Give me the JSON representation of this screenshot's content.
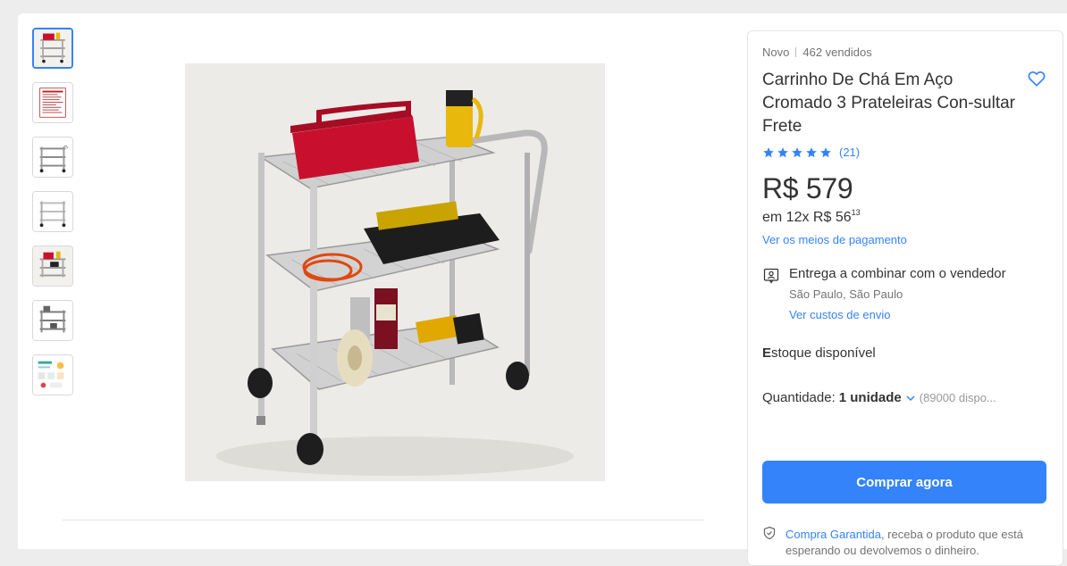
{
  "product": {
    "condition": "Novo",
    "sold": "462 vendidos",
    "title": "Carrinho De Chá Em Aço Cromado 3 Prateleiras Con-sultar Frete",
    "rating_stars": 5,
    "reviews": "(21)",
    "price": "R$ 579",
    "installments_prefix": "em 12x R$ 56",
    "installments_cents": "13",
    "payment_link": "Ver os meios de pagamento"
  },
  "delivery": {
    "title": "Entrega a combinar com o vendedor",
    "city": "São Paulo, São Paulo",
    "link": "Ver custos de envio"
  },
  "stock": {
    "first_letter": "E",
    "rest": "stoque disponível"
  },
  "quantity": {
    "label": "Quantidade:",
    "value": "1 unidade",
    "available": "(89000 dispo..."
  },
  "buy_button": "Comprar agora",
  "guarantee": {
    "link": "Compra Garantida",
    "text": ", receba o produto que está esperando ou devolvemos o dinheiro."
  },
  "gallery": {
    "thumb_count": 7,
    "active_index": 0
  },
  "colors": {
    "accent": "#3483fa",
    "toolbox_red": "#c8102e",
    "text": "#333333",
    "muted": "#737373"
  },
  "icons": [
    "heart-icon",
    "star-icon",
    "delivery-icon",
    "chevron-down-icon",
    "shield-check-icon"
  ]
}
